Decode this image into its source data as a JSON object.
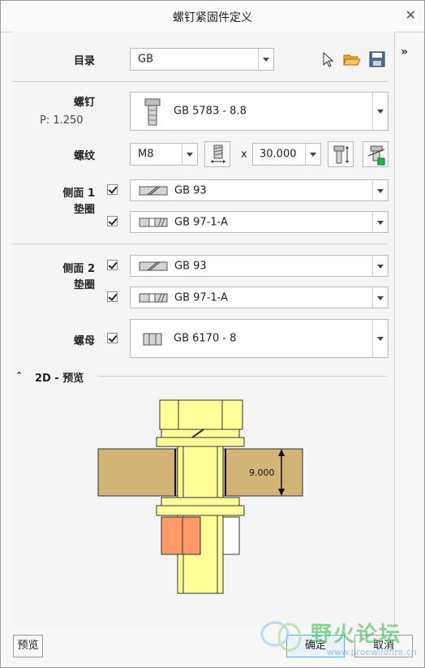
{
  "window": {
    "title": "螺钉紧固件定义"
  },
  "catalog": {
    "label": "目录",
    "value": "GB"
  },
  "screw": {
    "label": "螺钉",
    "pitch": "P: 1.250",
    "value": "GB 5783 - 8.8"
  },
  "thread": {
    "label": "螺纹",
    "size": "M8",
    "x": "x",
    "length": "30.000"
  },
  "side1": {
    "label": "侧面 1",
    "sublabel": "垫圈",
    "item1": "GB 93",
    "item2": "GB 97-1-A"
  },
  "side2": {
    "label": "侧面 2",
    "sublabel": "垫圈",
    "item1": "GB 93",
    "item2": "GB 97-1-A"
  },
  "nut": {
    "label": "螺母",
    "value": "GB 6170 - 8"
  },
  "preview": {
    "section_title": "2D - 预览",
    "dimension": "9.000"
  },
  "footer": {
    "preview_btn": "预览",
    "ok_btn": "确定",
    "cancel_btn": "取消"
  },
  "watermark": {
    "text": "野火论坛",
    "url": "www.proewildfire.cn"
  },
  "colors": {
    "bolt": "#ffff99",
    "plate": "#d2b476",
    "nut_orange": "#ff9966",
    "accent": "#4ea9e6"
  }
}
